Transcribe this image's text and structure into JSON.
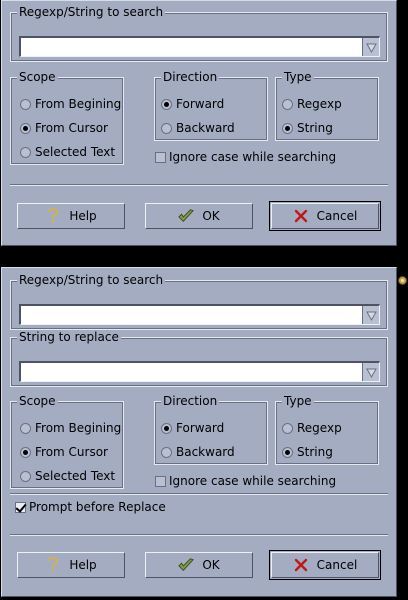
{
  "find_dialog": {
    "search_frame_label": "Regexp/String to search",
    "search_value": "",
    "scope": {
      "label": "Scope",
      "options": [
        "From Begining",
        "From Cursor",
        "Selected Text"
      ],
      "selected": 1
    },
    "direction": {
      "label": "Direction",
      "options": [
        "Forward",
        "Backward"
      ],
      "selected": 0
    },
    "type": {
      "label": "Type",
      "options": [
        "Regexp",
        "String"
      ],
      "selected": 1
    },
    "ignore_case_label": "Ignore case while searching",
    "ignore_case_checked": false,
    "buttons": {
      "help": "Help",
      "ok": "OK",
      "cancel": "Cancel"
    }
  },
  "replace_dialog": {
    "search_frame_label": "Regexp/String to search",
    "search_value": "",
    "replace_frame_label": "String to replace",
    "replace_value": "",
    "scope": {
      "label": "Scope",
      "options": [
        "From Begining",
        "From Cursor",
        "Selected Text"
      ],
      "selected": 1
    },
    "direction": {
      "label": "Direction",
      "options": [
        "Forward",
        "Backward"
      ],
      "selected": 0
    },
    "type": {
      "label": "Type",
      "options": [
        "Regexp",
        "String"
      ],
      "selected": 1
    },
    "ignore_case_label": "Ignore case while searching",
    "ignore_case_checked": false,
    "prompt_label": "Prompt before Replace",
    "prompt_checked": true,
    "buttons": {
      "help": "Help",
      "ok": "OK",
      "cancel": "Cancel"
    }
  },
  "icons": {
    "combo_arrow": "dropdown-arrow-icon",
    "help": "question-mark-icon",
    "ok": "checkmark-icon",
    "cancel": "red-x-icon",
    "close": "close-ball-icon"
  },
  "colors": {
    "dialog_bg": "#a4acc1",
    "input_bg": "#ffffff",
    "cancel_icon": "#c01818",
    "ok_icon": "#6f8a3a"
  }
}
